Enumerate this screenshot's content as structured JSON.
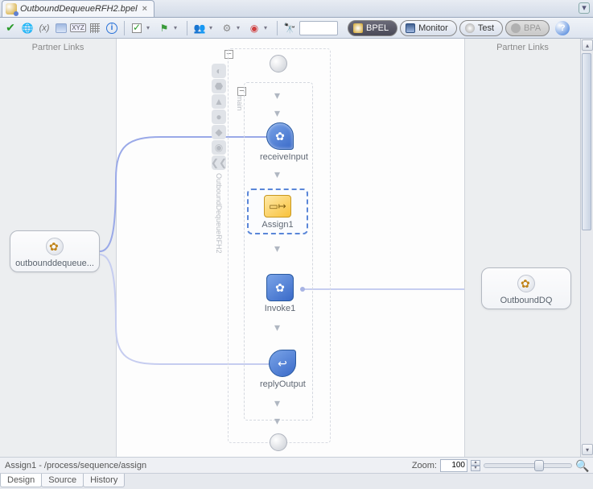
{
  "tab": {
    "title": "OutboundDequeueRFH2.bpel"
  },
  "toolbar": {
    "modes": {
      "bpel": "BPEL",
      "monitor": "Monitor",
      "test": "Test",
      "bpa": "BPA"
    },
    "search_placeholder": ""
  },
  "partner_links": {
    "header": "Partner Links",
    "left": {
      "label": "outbounddequeue..."
    },
    "right": {
      "label": "OutboundDQ"
    }
  },
  "process": {
    "tray_label": "OutboundDequeueRFH2",
    "main_label": "main",
    "nodes": {
      "receive": "receiveInput",
      "assign": "Assign1",
      "invoke": "Invoke1",
      "reply": "replyOutput"
    }
  },
  "status": {
    "breadcrumb": "Assign1 - /process/sequence/assign",
    "zoom_label": "Zoom:",
    "zoom_value": "100"
  },
  "bottom_tabs": {
    "design": "Design",
    "source": "Source",
    "history": "History"
  }
}
